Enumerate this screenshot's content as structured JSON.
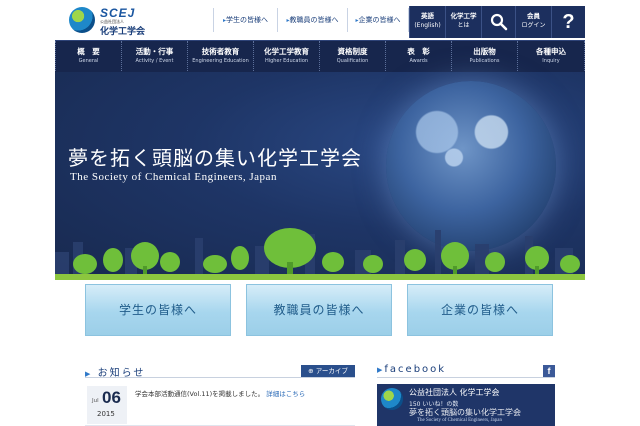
{
  "header": {
    "logo_en": "SCEJ",
    "logo_sub": "公益社団法人",
    "logo_jp": "化学工学会",
    "quick_links": [
      {
        "arrow": "▸",
        "label": "学生の皆様へ"
      },
      {
        "arrow": "▸",
        "label": "教職員の皆様へ"
      },
      {
        "arrow": "▸",
        "label": "企業の皆様へ"
      }
    ],
    "utility": {
      "english_title": "英語",
      "english_sub": "(English)",
      "about_title": "化学工学",
      "about_sub": "とは",
      "member_title": "会員",
      "member_sub": "ログイン",
      "help": "?"
    }
  },
  "nav": [
    {
      "jp": "概　要",
      "en": "General"
    },
    {
      "jp": "活動・行事",
      "en": "Activity / Event"
    },
    {
      "jp": "技術者教育",
      "en": "Engineering Education"
    },
    {
      "jp": "化学工学教育",
      "en": "Higher Education"
    },
    {
      "jp": "資格制度",
      "en": "Qualification"
    },
    {
      "jp": "表　彰",
      "en": "Awards"
    },
    {
      "jp": "出版物",
      "en": "Publications"
    },
    {
      "jp": "各種申込",
      "en": "Inquiry"
    }
  ],
  "hero": {
    "title": "夢を拓く頭脳の集い化学工学会",
    "subtitle": "The Society of Chemical Engineers, Japan"
  },
  "audience_buttons": [
    "学生の皆様へ",
    "教職員の皆様へ",
    "企業の皆様へ"
  ],
  "news": {
    "title": "お知らせ",
    "archive_label": "アーカイブ",
    "items": [
      {
        "month": "Jul",
        "day": "06",
        "year": "2015",
        "text": "学会本部活動通信(Vol.11)を掲載しました。",
        "link": "詳細はこちら"
      }
    ]
  },
  "facebook": {
    "title": "facebook",
    "icon_letter": "f",
    "page_name": "公益社団法人 化学工学会",
    "likes": "150 いいね！の数",
    "cover_title": "夢を拓く頭脳の集い化学工学会",
    "cover_sub": "The Society of Chemical Engineers, Japan"
  },
  "colors": {
    "navy": "#1c2f5e",
    "nav_dark": "#17264d",
    "accent_blue": "#2a4f8c",
    "button_light": "#a7d6ee",
    "tree_green": "#6fbf3a",
    "facebook": "#3b5998"
  }
}
